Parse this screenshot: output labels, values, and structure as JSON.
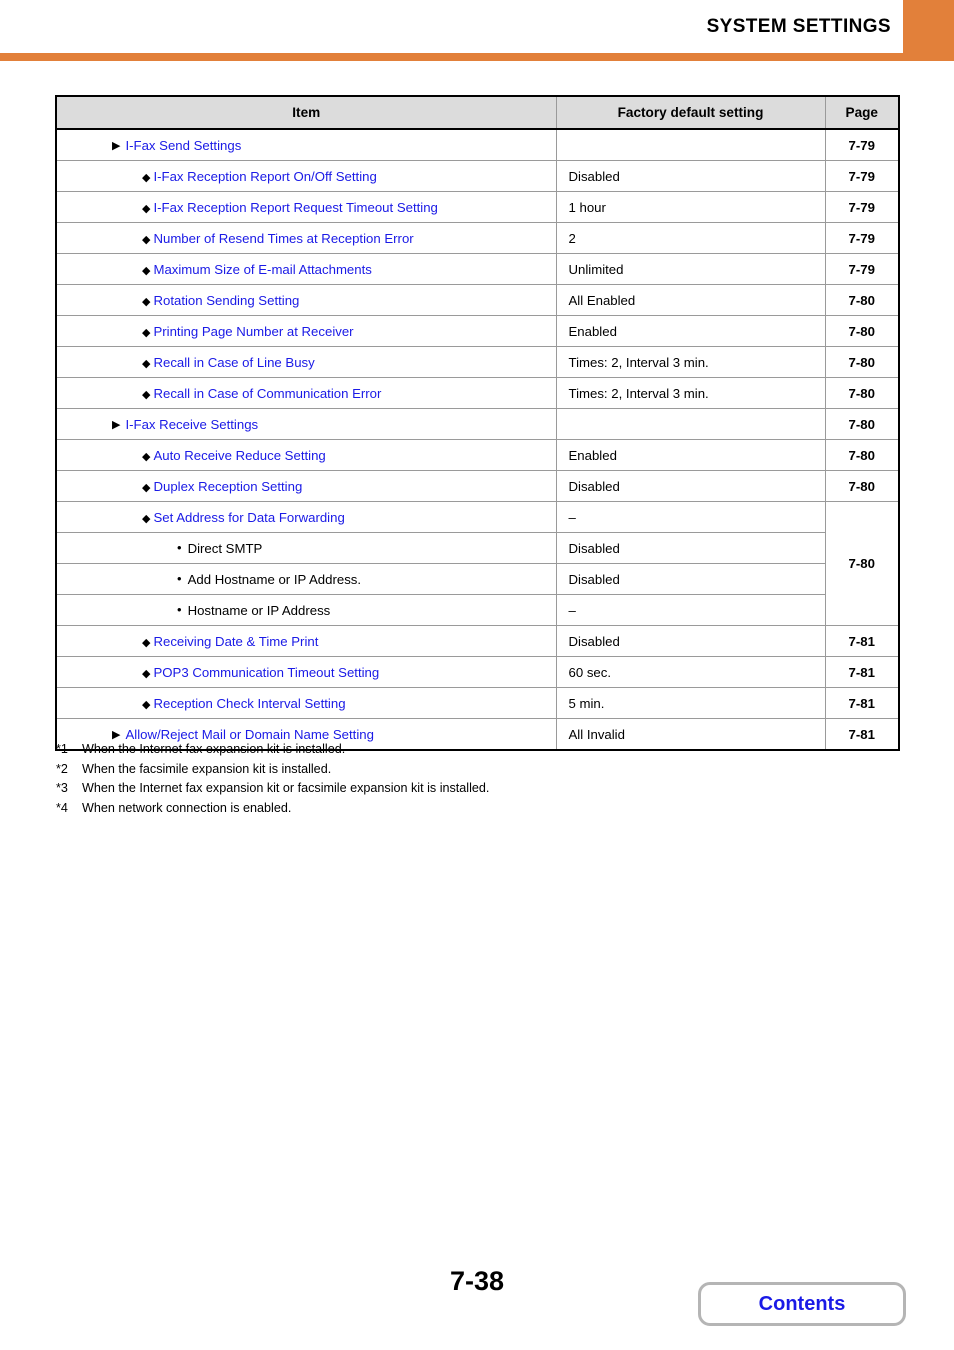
{
  "header": {
    "title": "SYSTEM SETTINGS",
    "accent_color": "#e2803a"
  },
  "table": {
    "columns": [
      "Item",
      "Factory default setting",
      "Page"
    ],
    "link_color": "#1a1ae6",
    "rows": [
      {
        "level": 1,
        "bullet": "triangle-right-icon",
        "item": "I-Fax Send Settings",
        "value": "",
        "page": "7-79",
        "link": true
      },
      {
        "level": 2,
        "bullet": "diamond-icon",
        "item": "I-Fax Reception Report On/Off Setting",
        "value": "Disabled",
        "page": "7-79",
        "link": true
      },
      {
        "level": 2,
        "bullet": "diamond-icon",
        "item": "I-Fax Reception Report Request Timeout Setting",
        "value": "1 hour",
        "page": "7-79",
        "link": true
      },
      {
        "level": 2,
        "bullet": "diamond-icon",
        "item": "Number of Resend Times at Reception Error",
        "value": "2",
        "page": "7-79",
        "link": true
      },
      {
        "level": 2,
        "bullet": "diamond-icon",
        "item": "Maximum Size of E-mail Attachments",
        "value": "Unlimited",
        "page": "7-79",
        "link": true
      },
      {
        "level": 2,
        "bullet": "diamond-icon",
        "item": "Rotation Sending Setting",
        "value": "All Enabled",
        "page": "7-80",
        "link": true
      },
      {
        "level": 2,
        "bullet": "diamond-icon",
        "item": "Printing Page Number at Receiver",
        "value": "Enabled",
        "page": "7-80",
        "link": true
      },
      {
        "level": 2,
        "bullet": "diamond-icon",
        "item": "Recall in Case of Line Busy",
        "value": "Times: 2, Interval 3 min.",
        "page": "7-80",
        "link": true
      },
      {
        "level": 2,
        "bullet": "diamond-icon",
        "item": "Recall in Case of Communication Error",
        "value": "Times: 2, Interval 3 min.",
        "page": "7-80",
        "link": true
      },
      {
        "level": 1,
        "bullet": "triangle-right-icon",
        "item": "I-Fax Receive Settings",
        "value": "",
        "page": "7-80",
        "link": true
      },
      {
        "level": 2,
        "bullet": "diamond-icon",
        "item": "Auto Receive Reduce Setting",
        "value": "Enabled",
        "page": "7-80",
        "link": true
      },
      {
        "level": 2,
        "bullet": "diamond-icon",
        "item": "Duplex Reception Setting",
        "value": "Disabled",
        "page": "7-80",
        "link": true
      },
      {
        "level": 2,
        "bullet": "diamond-icon",
        "item": "Set Address for Data Forwarding",
        "value": "–",
        "page": "7-80",
        "link": true,
        "page_rowspan": 4
      },
      {
        "level": 3,
        "bullet": "dot-icon",
        "item": "Direct SMTP",
        "value": "Disabled",
        "page": null,
        "link": false
      },
      {
        "level": 3,
        "bullet": "dot-icon",
        "item": "Add Hostname or IP Address.",
        "value": "Disabled",
        "page": null,
        "link": false
      },
      {
        "level": 3,
        "bullet": "dot-icon",
        "item": "Hostname or IP Address",
        "value": "–",
        "page": null,
        "link": false
      },
      {
        "level": 2,
        "bullet": "diamond-icon",
        "item": "Receiving Date & Time Print",
        "value": "Disabled",
        "page": "7-81",
        "link": true
      },
      {
        "level": 2,
        "bullet": "diamond-icon",
        "item": "POP3 Communication Timeout Setting",
        "value": "60 sec.",
        "page": "7-81",
        "link": true
      },
      {
        "level": 2,
        "bullet": "diamond-icon",
        "item": "Reception Check Interval Setting",
        "value": "5 min.",
        "page": "7-81",
        "link": true
      },
      {
        "level": 1,
        "bullet": "triangle-right-icon",
        "item": "Allow/Reject Mail or Domain Name Setting",
        "value": "All Invalid",
        "page": "7-81",
        "link": true
      }
    ]
  },
  "footnotes": [
    {
      "mark": "*1",
      "text": "When the Internet fax expansion kit is installed."
    },
    {
      "mark": "*2",
      "text": "When the facsimile expansion kit is installed."
    },
    {
      "mark": "*3",
      "text": "When the Internet fax expansion kit or facsimile expansion kit is installed."
    },
    {
      "mark": "*4",
      "text": "When network connection is enabled."
    }
  ],
  "footer": {
    "page_number": "7-38",
    "contents_label": "Contents"
  }
}
